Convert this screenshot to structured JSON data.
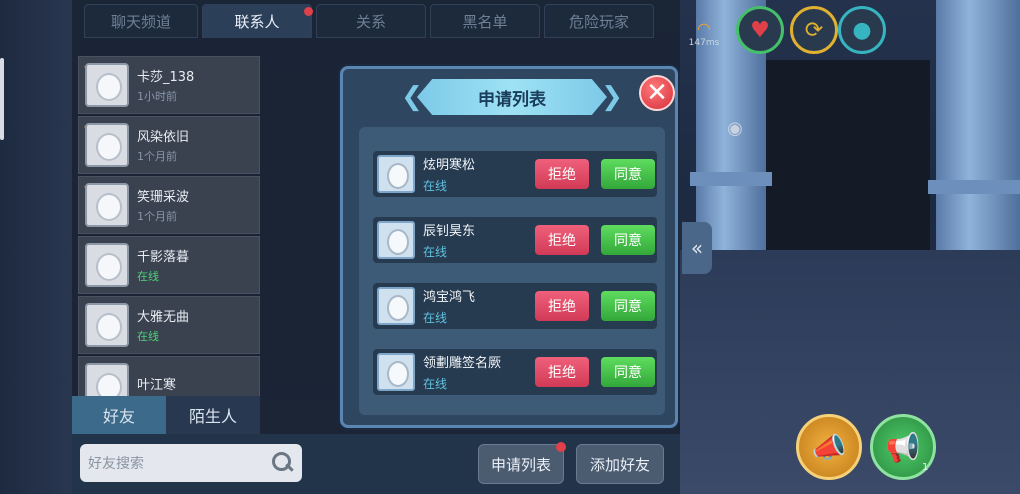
{
  "top_tabs": [
    {
      "label": "聊天频道",
      "active": false
    },
    {
      "label": "联系人",
      "active": true,
      "badge": true
    },
    {
      "label": "关系",
      "active": false
    },
    {
      "label": "黑名单",
      "active": false
    },
    {
      "label": "危险玩家",
      "active": false
    }
  ],
  "contacts": [
    {
      "name": "卡莎_138",
      "status": "1小时前",
      "online": false
    },
    {
      "name": "风染依旧",
      "status": "1个月前",
      "online": false
    },
    {
      "name": "笑珊采波",
      "status": "1个月前",
      "online": false
    },
    {
      "name": "千影落暮",
      "status": "在线",
      "online": true
    },
    {
      "name": "大雅无曲",
      "status": "在线",
      "online": true
    },
    {
      "name": "叶江寒",
      "status": "",
      "online": false
    }
  ],
  "bottom_tabs": {
    "friends": "好友",
    "strangers": "陌生人"
  },
  "search": {
    "placeholder": "好友搜索"
  },
  "buttons": {
    "requests": "申请列表",
    "add_friend": "添加好友"
  },
  "modal": {
    "title": "申请列表",
    "reject_label": "拒绝",
    "accept_label": "同意",
    "requests": [
      {
        "name": "炫明寒松",
        "status": "在线"
      },
      {
        "name": "辰钊昊东",
        "status": "在线"
      },
      {
        "name": "鸿宝鸿飞",
        "status": "在线"
      },
      {
        "name": "领劃雕签名厥",
        "status": "在线"
      }
    ]
  },
  "hud": {
    "ping": "147ms",
    "counter": "1"
  },
  "colors": {
    "reject": "#d13a56",
    "accept": "#33a83a",
    "online": "#4fd07a",
    "badge": "#e0404a"
  }
}
